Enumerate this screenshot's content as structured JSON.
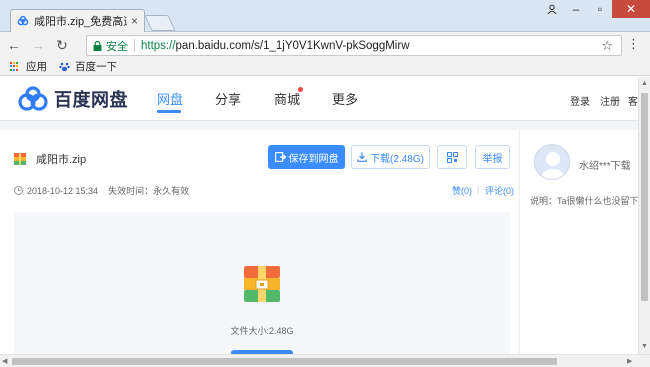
{
  "browser": {
    "tab_title": "咸阳市.zip_免费高速下载",
    "secure_label": "安全",
    "url_scheme": "https://",
    "url_rest": "pan.baidu.com/s/1_1jY0V1KwnV-pkSoggMirw",
    "bookmarks": [
      "应用",
      "百度一下"
    ]
  },
  "site": {
    "logo_text": "百度网盘",
    "nav": [
      "网盘",
      "分享",
      "商城",
      "更多"
    ],
    "active_nav": "网盘",
    "header_links": [
      "登录",
      "注册",
      "客"
    ],
    "brand_color": "#3b8cff"
  },
  "file": {
    "name": "咸阳市.zip",
    "save_button": "保存到网盘",
    "download_button": "下载(2.48G)",
    "report_button": "举报",
    "date": "2018-10-12 15:34",
    "expire": "失效时间：永久有效",
    "likes": "赞(0)",
    "comments": "评论(0)",
    "size_text": "文件大小:2.48G"
  },
  "sidebar": {
    "uploader": "水绍***下载",
    "description": "说明：Ta很懒什么也没留下。"
  }
}
